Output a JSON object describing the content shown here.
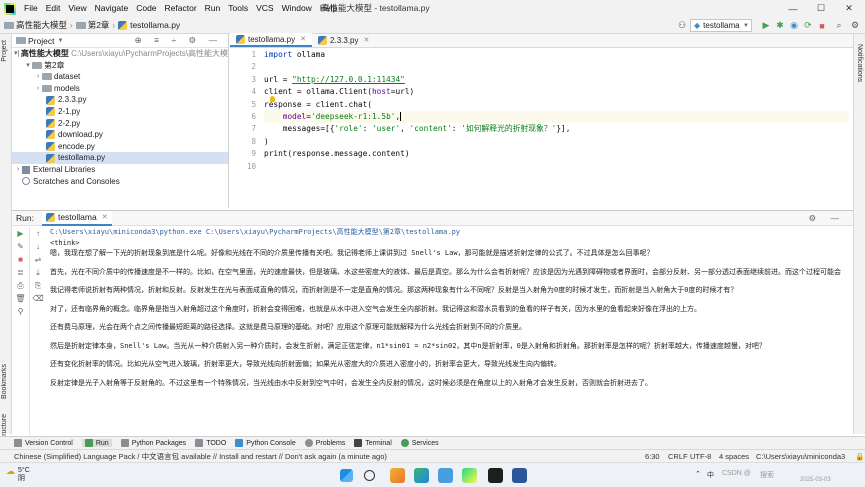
{
  "menubar": {
    "items": [
      "File",
      "Edit",
      "View",
      "Navigate",
      "Code",
      "Refactor",
      "Run",
      "Tools",
      "VCS",
      "Window",
      "Help"
    ],
    "title": "高性能大模型 - testollama.py",
    "controls": {
      "minimize": "—",
      "maximize": "☐",
      "close": "✕"
    }
  },
  "navbar": {
    "breadcrumbs": [
      "高性能大模型",
      "第2章",
      "testollama.py"
    ],
    "run_config": "testollama"
  },
  "project": {
    "header": "Project",
    "root_name": "高性能大模型",
    "root_path": "C:\\Users\\xiayu\\PycharmProjects\\高性能大模",
    "folder": "第2章",
    "subfolders": [
      "dataset",
      "models"
    ],
    "files": [
      "2.3.3.py",
      "2-1.py",
      "2-2.py",
      "download.py",
      "encode.py",
      "testollama.py"
    ],
    "external": "External Libraries",
    "scratches": "Scratches and Consoles"
  },
  "editor": {
    "tabs": [
      "testollama.py",
      "2.3.3.py"
    ],
    "line_numbers": [
      "1",
      "2",
      "3",
      "4",
      "5",
      "6",
      "7",
      "8",
      "9",
      "10"
    ],
    "code": {
      "l1_kw": "import",
      "l1_rest": " ollama",
      "l3_a": "url = ",
      "l3_url": "\"http://127.0.0.1:11434\"",
      "l4_a": "client = ollama.Client(",
      "l4_p": "host",
      "l4_b": "=url)",
      "l5": "response = client.chat(",
      "l6_ind": "    ",
      "l6_p": "model",
      "l6_eq": "=",
      "l6_s": "'deepseek-r1:1.5b'",
      "l6_c": ",",
      "l7_a": "    messages=[{",
      "l7_s1": "'role'",
      "l7_b": ": ",
      "l7_s2": "'user'",
      "l7_c": ", ",
      "l7_s3": "'content'",
      "l7_d": ": ",
      "l7_s4": "'如何解释光的折射现象？'",
      "l7_e": "}],",
      "l8": ")",
      "l9": "print(response.message.content)"
    }
  },
  "run": {
    "label": "Run:",
    "tab": "testollama",
    "command": "C:\\Users\\xiayu\\miniconda3\\python.exe C:\\Users\\xiayu\\PycharmProjects\\高性能大模型\\第2章\\testollama.py",
    "output": [
      "<think>",
      "嗯，我现在想了解一下光的折射现象到底是什么呢。好像和光线在不同的介质里传播有关吧。我记得老师上课讲到过 Snell's Law，那可能就是描述折射定律的公式了。不过具体是怎么回事呢？",
      "",
      "首先，光在不同介质中的传播速度是不一样的。比如，在空气里面，光的速度最快，但是玻璃、水这些密度大的液体、最后是真空。那么为什么会有折射呢？应该是因为光遇到障碍物或者界面时，会部分反射、另一部分透过表面继续前进。而这个过程可能会",
      "",
      "我记得老师说折射有两种情况，折射和反射。反射发生在光与表面成直角的情况，而折射则是不一定是直角的情况。那这两种现象有什么不同呢？反射是当入射角为0度的时候才发生，而折射是当入射角大于0度的时候才有？",
      "",
      "对了，还有临界角的概念。临界角是指当入射角超过这个角度时，折射会变得困难，也就是从水中进入空气会发生全内部折射。我记得这和潜水员看到的鱼看的样子有关，因为水里的鱼看起来好像在浮出的上方。",
      "",
      "还有费马原理，光会在两个点之间传播最短距离的路径选择。这就是费马原理的基础。对吧？应用这个原理可能就解释为什么光线会折射到不同的介质里。",
      "",
      "然后是折射定律本身，Snell's Law。当光从一种介质射入另一种介质时，会发生折射，满足正弦定律，n1*sin01 = n2*sin02，其中n是折射率，0是入射角和折射角。那折射率是怎样的呢？折射率越大，传播速度越慢，对吧？",
      "",
      "还有变化折射率的情况。比如光从空气进入玻璃，折射率更大，导致光线向折射面偏；如果光从密度大的介质进入密度小的，折射率会更大，导致光线发生向内偏转。",
      "",
      "反射定律是光子入射角等于反射角的。不过这里有一个特殊情况，当光线由水中反射到空气中时，会发生全内反射的情况，这时候必须是在角度以上的入射角才会发生反射，否则就会折射进去了。"
    ]
  },
  "bottom_tools": [
    "Version Control",
    "Run",
    "Python Packages",
    "TODO",
    "Python Console",
    "Problems",
    "Terminal",
    "Services"
  ],
  "statusbar": {
    "message": "Chinese (Simplified) Language Pack / 中文语言包 available // Install and restart // Don't ask again (a minute ago)",
    "position": "6:30",
    "line_sep": "CRLF",
    "encoding": "UTF-8",
    "indent": "4 spaces",
    "interpreter": "C:\\Users\\xiayu\\miniconda3"
  },
  "taskbar": {
    "weather_temp": "5°C",
    "weather_desc": "阴",
    "tray_lang": "中",
    "watermark": "CSDN @",
    "clock_date": "2025-03-03",
    "search_label": "搜索"
  },
  "colors": {
    "accent": "#4083c9",
    "keyword": "#0033b3",
    "string": "#067d17",
    "param": "#660099",
    "run_green": "#499c54",
    "stop_red": "#db5860"
  },
  "icons": [
    "pycharm-logo-icon",
    "folder-icon",
    "python-file-icon",
    "run-icon",
    "debug-icon",
    "stop-icon",
    "search-icon",
    "gear-icon",
    "bulb-icon",
    "windows-start-icon"
  ]
}
